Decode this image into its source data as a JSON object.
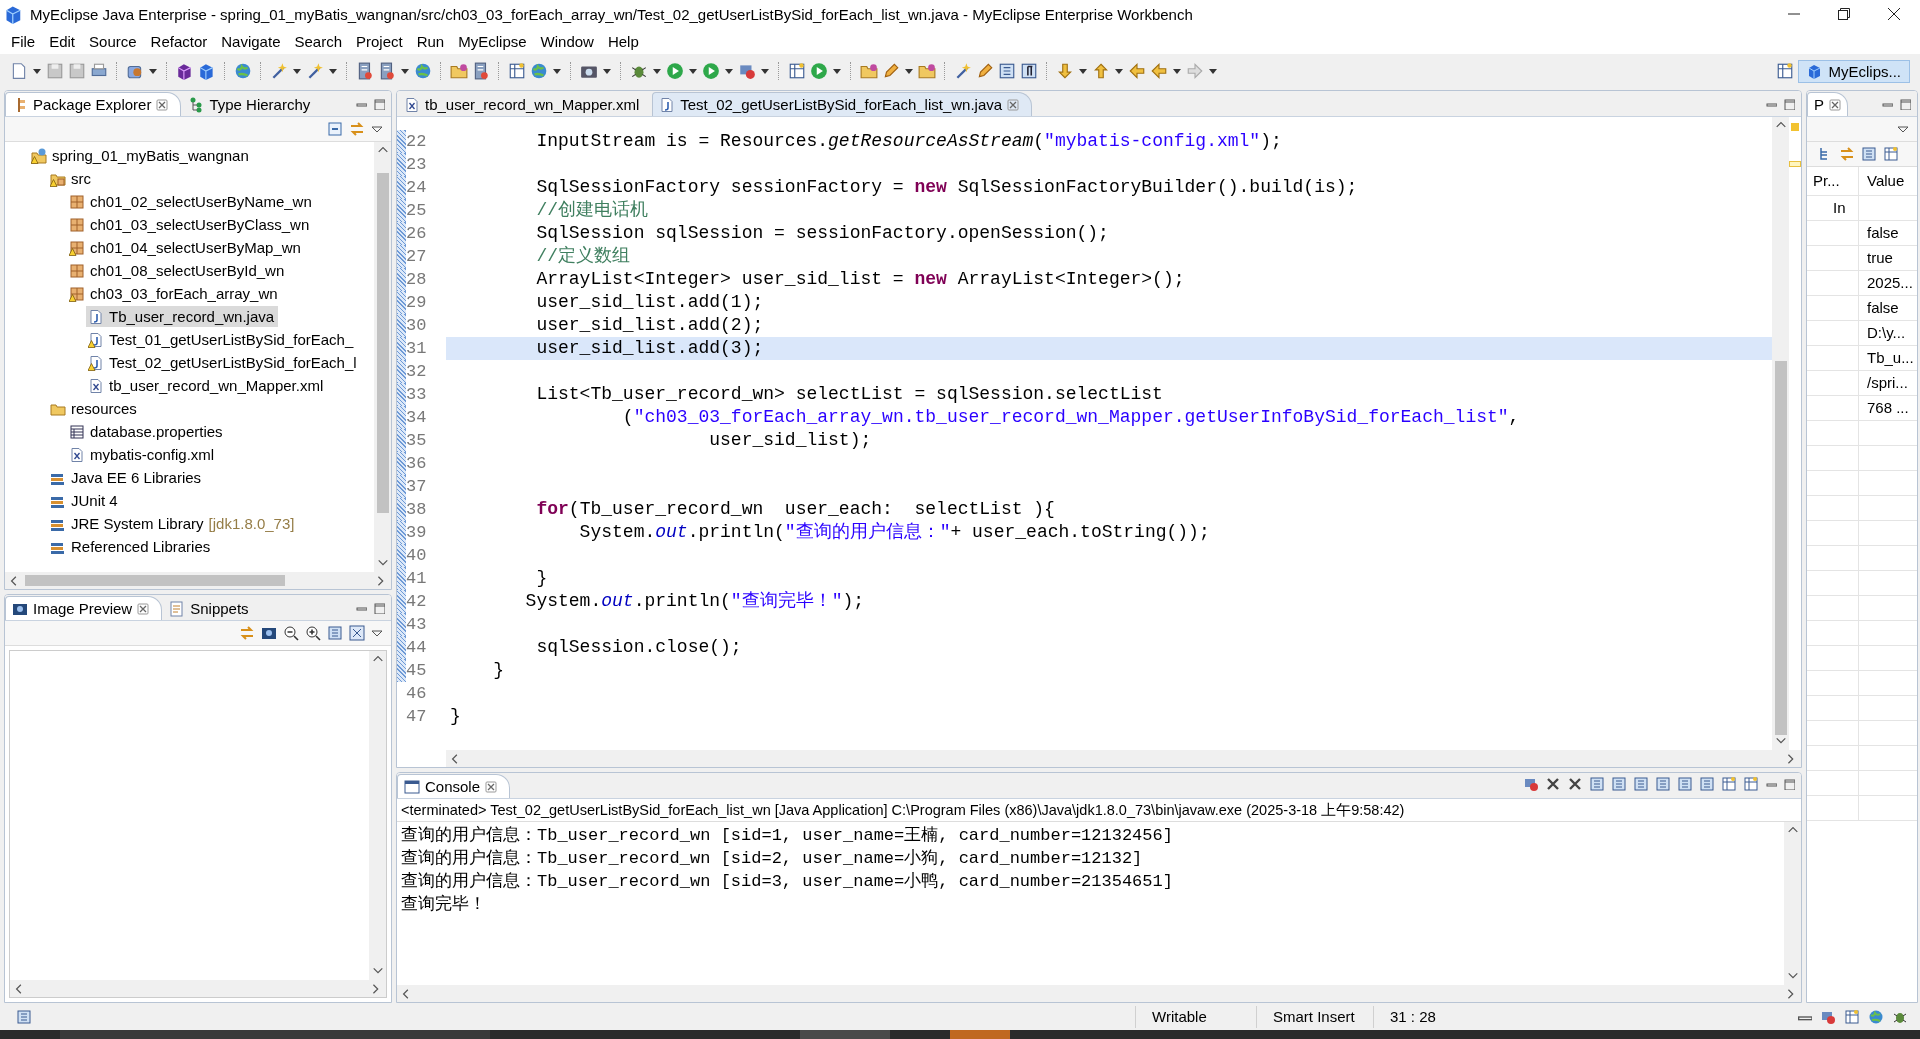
{
  "window": {
    "title": "MyEclipse Java Enterprise - spring_01_myBatis_wangnan/src/ch03_03_forEach_array_wn/Test_02_getUserListBySid_forEach_list_wn.java - MyEclipse Enterprise Workbench"
  },
  "menu": [
    "File",
    "Edit",
    "Source",
    "Refactor",
    "Navigate",
    "Search",
    "Project",
    "Run",
    "MyEclipse",
    "Window",
    "Help"
  ],
  "perspective": {
    "label": "MyEclips...",
    "selected": true
  },
  "package_explorer": {
    "tabs": [
      {
        "label": "Package Explorer",
        "kind": "explorer",
        "selected": true
      },
      {
        "label": "Type Hierarchy",
        "kind": "hierarchy",
        "selected": false
      }
    ],
    "tree": [
      {
        "label": "spring_01_myBatis_wangnan",
        "kind": "project",
        "warning": true,
        "selected": false,
        "children": [
          {
            "label": "src",
            "kind": "source",
            "warning": true,
            "selected": false,
            "children": [
              {
                "label": "ch01_02_selectUserByName_wn",
                "kind": "package",
                "warning": false,
                "selected": false
              },
              {
                "label": "ch01_03_selectUserByClass_wn",
                "kind": "package",
                "warning": false,
                "selected": false
              },
              {
                "label": "ch01_04_selectUserByMap_wn",
                "kind": "package",
                "warning": true,
                "selected": false
              },
              {
                "label": "ch01_08_selectUserById_wn",
                "kind": "package",
                "warning": false,
                "selected": false
              },
              {
                "label": "ch03_03_forEach_array_wn",
                "kind": "package",
                "warning": true,
                "selected": false,
                "children": [
                  {
                    "label": "Tb_user_record_wn.java",
                    "kind": "java",
                    "warning": false,
                    "selected": true
                  },
                  {
                    "label": "Test_01_getUserListBySid_forEach_",
                    "kind": "java",
                    "warning": true,
                    "selected": false
                  },
                  {
                    "label": "Test_02_getUserListBySid_forEach_l",
                    "kind": "java",
                    "warning": true,
                    "selected": false
                  },
                  {
                    "label": "tb_user_record_wn_Mapper.xml",
                    "kind": "xml",
                    "warning": false,
                    "selected": false
                  }
                ]
              }
            ]
          },
          {
            "label": "resources",
            "kind": "folder",
            "warning": false,
            "selected": false,
            "children": [
              {
                "label": "database.properties",
                "kind": "properties",
                "warning": false,
                "selected": false
              },
              {
                "label": "mybatis-config.xml",
                "kind": "xml",
                "warning": false,
                "selected": false
              }
            ]
          },
          {
            "label": "Java EE 6 Libraries",
            "kind": "library",
            "warning": false,
            "selected": false
          },
          {
            "label": "JUnit 4",
            "kind": "library",
            "warning": false,
            "selected": false
          },
          {
            "label": "JRE System Library",
            "decoration": "[jdk1.8.0_73]",
            "kind": "library",
            "warning": false,
            "selected": false
          },
          {
            "label": "Referenced Libraries",
            "kind": "library",
            "warning": false,
            "selected": false
          }
        ]
      }
    ]
  },
  "image_preview": {
    "tabs": [
      {
        "label": "Image Preview",
        "kind": "image",
        "selected": true
      },
      {
        "label": "Snippets",
        "kind": "snippets",
        "selected": false
      }
    ]
  },
  "editor": {
    "tabs": [
      {
        "label": "tb_user_record_wn_Mapper.xml",
        "kind": "xml",
        "selected": false
      },
      {
        "label": "Test_02_getUserListBySid_forEach_list_wn.java",
        "kind": "java",
        "selected": true
      }
    ],
    "lines": [
      {
        "number": "22",
        "in_scope": true,
        "current": false,
        "segments": [
          {
            "kind": "plain",
            "text": "        InputStream is = Resources."
          },
          {
            "kind": "italic",
            "text": "getResourceAsStream"
          },
          {
            "kind": "plain",
            "text": "("
          },
          {
            "kind": "string",
            "text": "\"mybatis-config.xml\""
          },
          {
            "kind": "plain",
            "text": ");"
          }
        ]
      },
      {
        "number": "23",
        "in_scope": true,
        "current": false
      },
      {
        "number": "24",
        "in_scope": true,
        "current": false,
        "segments": [
          {
            "kind": "plain",
            "text": "        SqlSessionFactory sessionFactory = "
          },
          {
            "kind": "keyword",
            "text": "new"
          },
          {
            "kind": "plain",
            "text": " SqlSessionFactoryBuilder().build(is);"
          }
        ]
      },
      {
        "number": "25",
        "in_scope": true,
        "current": false,
        "segments": [
          {
            "kind": "comment",
            "text": "        //创建电话机"
          }
        ]
      },
      {
        "number": "26",
        "in_scope": true,
        "current": false,
        "segments": [
          {
            "kind": "plain",
            "text": "        SqlSession sqlSession = sessionFactory.openSession();"
          }
        ]
      },
      {
        "number": "27",
        "in_scope": true,
        "current": false,
        "segments": [
          {
            "kind": "comment",
            "text": "        //定义数组"
          }
        ]
      },
      {
        "number": "28",
        "in_scope": true,
        "current": false,
        "segments": [
          {
            "kind": "plain",
            "text": "        ArrayList<Integer> user_sid_list = "
          },
          {
            "kind": "keyword",
            "text": "new"
          },
          {
            "kind": "plain",
            "text": " ArrayList<Integer>();"
          }
        ]
      },
      {
        "number": "29",
        "in_scope": true,
        "current": false,
        "segments": [
          {
            "kind": "plain",
            "text": "        user_sid_list.add(1);"
          }
        ]
      },
      {
        "number": "30",
        "in_scope": true,
        "current": false,
        "segments": [
          {
            "kind": "plain",
            "text": "        user_sid_list.add(2);"
          }
        ]
      },
      {
        "number": "31",
        "in_scope": true,
        "current": true,
        "segments": [
          {
            "kind": "plain",
            "text": "        user_sid_list.add(3);"
          }
        ]
      },
      {
        "number": "32",
        "in_scope": true,
        "current": false
      },
      {
        "number": "33",
        "in_scope": true,
        "current": false,
        "segments": [
          {
            "kind": "plain",
            "text": "        List<Tb_user_record_wn> selectList = sqlSession.selectList"
          }
        ]
      },
      {
        "number": "34",
        "in_scope": true,
        "current": false,
        "segments": [
          {
            "kind": "plain",
            "text": "                ("
          },
          {
            "kind": "string",
            "text": "\"ch03_03_forEach_array_wn.tb_user_record_wn_Mapper.getUserInfoBySid_forEach_list\""
          },
          {
            "kind": "plain",
            "text": ","
          }
        ]
      },
      {
        "number": "35",
        "in_scope": true,
        "current": false,
        "segments": [
          {
            "kind": "plain",
            "text": "                        user_sid_list);"
          }
        ]
      },
      {
        "number": "36",
        "in_scope": true,
        "current": false
      },
      {
        "number": "37",
        "in_scope": true,
        "current": false
      },
      {
        "number": "38",
        "in_scope": true,
        "current": false,
        "segments": [
          {
            "kind": "keyword",
            "text": "        for"
          },
          {
            "kind": "plain",
            "text": "(Tb_user_record_wn  user_each:  selectList ){"
          }
        ]
      },
      {
        "number": "39",
        "in_scope": true,
        "current": false,
        "segments": [
          {
            "kind": "plain",
            "text": "            System."
          },
          {
            "kind": "field",
            "text": "out"
          },
          {
            "kind": "plain",
            "text": ".println("
          },
          {
            "kind": "string",
            "text": "\"查询的用户信息：\""
          },
          {
            "kind": "plain",
            "text": "+ user_each.toString());"
          }
        ]
      },
      {
        "number": "40",
        "in_scope": true,
        "current": false
      },
      {
        "number": "41",
        "in_scope": true,
        "current": false,
        "segments": [
          {
            "kind": "plain",
            "text": "        }"
          }
        ]
      },
      {
        "number": "42",
        "in_scope": true,
        "current": false,
        "segments": [
          {
            "kind": "plain",
            "text": "       System."
          },
          {
            "kind": "field",
            "text": "out"
          },
          {
            "kind": "plain",
            "text": ".println("
          },
          {
            "kind": "string",
            "text": "\"查询完毕！\""
          },
          {
            "kind": "plain",
            "text": ");"
          }
        ]
      },
      {
        "number": "43",
        "in_scope": true,
        "current": false
      },
      {
        "number": "44",
        "in_scope": true,
        "current": false,
        "segments": [
          {
            "kind": "plain",
            "text": "        sqlSession.close();"
          }
        ]
      },
      {
        "number": "45",
        "in_scope": true,
        "current": false,
        "segments": [
          {
            "kind": "plain",
            "text": "    }"
          }
        ]
      },
      {
        "number": "46",
        "in_scope": false,
        "current": false
      },
      {
        "number": "47",
        "in_scope": false,
        "current": false,
        "segments": [
          {
            "kind": "plain",
            "text": "}"
          }
        ]
      }
    ]
  },
  "properties": {
    "tab": "P",
    "columns": [
      "Pr...",
      "Value"
    ],
    "rows": [
      {
        "property": "In"
      },
      {
        "value": "false"
      },
      {
        "value": "true"
      },
      {
        "value": "2025..."
      },
      {
        "value": "false"
      },
      {
        "value": "D:\\y..."
      },
      {
        "value": "Tb_u..."
      },
      {
        "value": "/spri..."
      },
      {
        "value": "768 ..."
      }
    ]
  },
  "console": {
    "tab": "Console",
    "description": "<terminated> Test_02_getUserListBySid_forEach_list_wn [Java Application] C:\\Program Files (x86)\\Java\\jdk1.8.0_73\\bin\\javaw.exe (2025-3-18 上午9:58:42)",
    "output": [
      "查询的用户信息：Tb_user_record_wn [sid=1, user_name=王楠, card_number=12132456]",
      "查询的用户信息：Tb_user_record_wn [sid=2, user_name=小狗, card_number=12132]",
      "查询的用户信息：Tb_user_record_wn [sid=3, user_name=小鸭, card_number=21354651]",
      "查询完毕！"
    ]
  },
  "status_bar": {
    "fields": [
      "Writable",
      "Smart Insert",
      "31 : 28"
    ]
  }
}
